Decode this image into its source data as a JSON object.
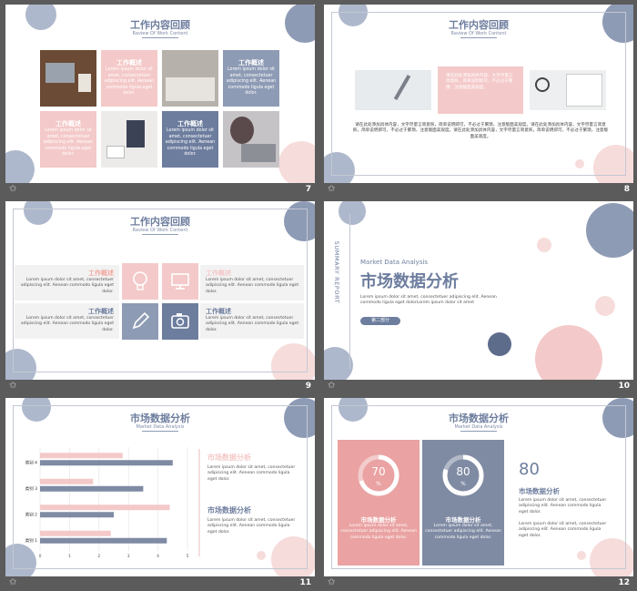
{
  "colors": {
    "blue": "#8e9bb5",
    "blue_dark": "#6d7d9e",
    "pink": "#f4c9c9",
    "panel_bg": "#5b5b5b"
  },
  "slides": {
    "s7": {
      "num": "7",
      "title": "工作内容回顾",
      "subtitle": "Raview Of Work Content",
      "tile1": {
        "head": "工作概述",
        "text": "Lorem ipsum dolor sit amet, consectetuer adipiscing elit. Aenean commodo ligula eget dolor."
      },
      "tile2": {
        "head": "工作概述",
        "text": "Lorem ipsum dolor sit amet, consectetuer adipiscing elit. Aenean commodo ligula eget dolor."
      },
      "tile3": {
        "head": "工作概述",
        "text": "Lorem ipsum dolor sit amet, consectetuer adipiscing elit. Aenean commodo ligula eget dolor."
      },
      "tile4": {
        "head": "工作概述",
        "text": "Lorem ipsum dolor sit amet, consectetuer adipiscing elit. Aenean commodo ligula eget dolor."
      }
    },
    "s8": {
      "num": "8",
      "title": "工作内容回顾",
      "subtitle": "Raview Of Work Content",
      "pink_text": "请在此处添加具体内容，文字尽量言简意赅，简单说明即可，不必过于繁琐，注意版面美观度。",
      "body": "请在此处添加具体内容，文字尽量言简意赅，简单说明即可，不必过于繁琐，注意版面美观度。请在此处添加具体内容，文字尽量言简意赅，简单说明即可，不必过于繁琐，注意版面美观度。请在此处添加具体内容，文字尽量言简意赅，简单说明即可，不必过于繁琐，注意版面美观度。"
    },
    "s9": {
      "num": "9",
      "title": "工作内容回顾",
      "subtitle": "Raview Of Work Content",
      "items": [
        {
          "head": "工作概述",
          "text": "Lorem ipsum dolor sit amet, consectetuer adipiscing elit. Aenean commodo ligula eget dolor."
        },
        {
          "head": "工作概述",
          "text": "Lorem ipsum dolor sit amet, consectetuer adipiscing elit. Aenean commodo ligula eget dolor."
        },
        {
          "head": "工作概述",
          "text": "Lorem ipsum dolor sit amet, consectetuer adipiscing elit. Aenean commodo ligula eget dolor."
        },
        {
          "head": "工作概述",
          "text": "Lorem ipsum dolor sit amet, consectetuer adipiscing elit. Aenean commodo ligula eget dolor."
        }
      ],
      "icons": [
        "lightbulb-icon",
        "monitor-icon",
        "pencil-icon",
        "camera-icon"
      ]
    },
    "s10": {
      "num": "10",
      "side_label": "SUMMARY REPORT",
      "en": "Market Data Analysis",
      "title": "市场数据分析",
      "body": "Lorem ipsum dolor sit amet, consectetuer adipiscing elit. Aenean commodo ligula eget dolorLorem ipsum dolor sit amet",
      "pill": "第二部分"
    },
    "s11": {
      "num": "11",
      "title": "市场数据分析",
      "subtitle": "Market Data Analysis",
      "side1": {
        "head": "市场数据分析",
        "text": "Lorem ipsum dolor sit amet, consectetuer adipiscing elit. Aenean commodo ligula eget dolor."
      },
      "side2": {
        "head": "市场数据分析",
        "text": "Lorem ipsum dolor sit amet, consectetuer adipiscing elit. Aenean commodo ligula eget dolor."
      }
    },
    "s12": {
      "num": "12",
      "title": "市场数据分析",
      "subtitle": "Market Data Analysis",
      "card1": {
        "value": "70",
        "unit": "%",
        "head": "市场数据分析",
        "text": "Lorem ipsum dolor sit amet, consectetuer adipiscing elit. Aenean commodo ligula eget dolor."
      },
      "card2": {
        "value": "80",
        "unit": "%",
        "head": "市场数据分析",
        "text": "Lorem ipsum dolor sit amet, consectetuer adipiscing elit. Aenean commodo ligula eget dolor."
      },
      "big_num": "80",
      "right_head": "市场数据分析",
      "right_text1": "Lorem ipsum dolor sit amet, consectetuer adipiscing elit. Aenean commodo ligula eget dolor.",
      "right_text2": "Lorem ipsum dolor sit amet, consectetuer adipiscing elit. Aenean commodo ligula eget dolor."
    }
  },
  "chart_data": {
    "type": "bar",
    "orientation": "horizontal",
    "categories": [
      "类别 1",
      "类别 2",
      "类别 3",
      "类别 4"
    ],
    "series": [
      {
        "color": "#f4c9c9",
        "values": [
          2.4,
          4.4,
          1.8,
          2.8
        ]
      },
      {
        "color": "#7f8aa3",
        "values": [
          4.3,
          2.5,
          3.5,
          4.5
        ]
      }
    ],
    "xticks": [
      "0",
      "1",
      "2",
      "3",
      "4",
      "5"
    ],
    "xlim": [
      0,
      5
    ]
  }
}
